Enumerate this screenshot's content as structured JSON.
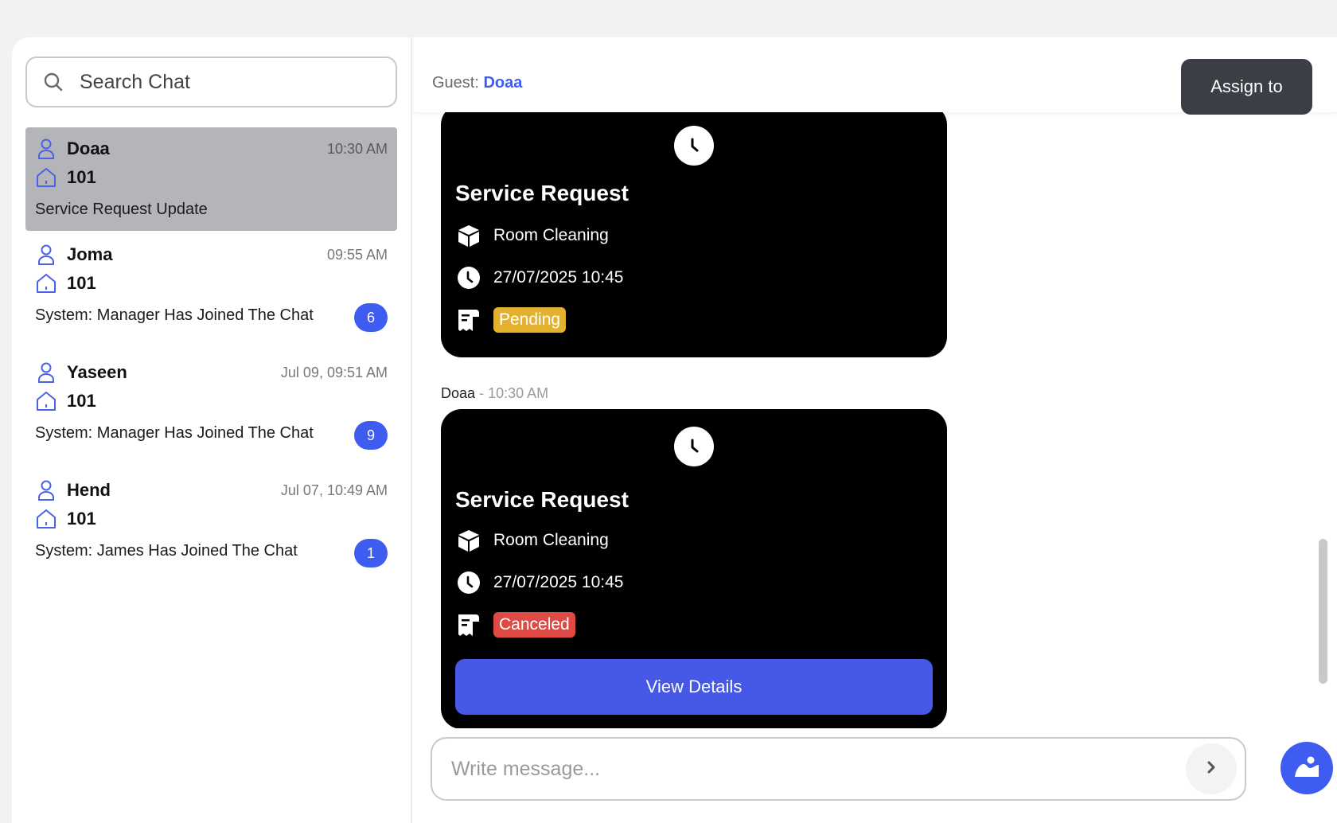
{
  "search": {
    "placeholder": "Search Chat"
  },
  "chats": [
    {
      "name": "Doaa",
      "time": "10:30 AM",
      "room": "101",
      "message": "Service Request Update",
      "unread": ""
    },
    {
      "name": "Joma",
      "time": "09:55 AM",
      "room": "101",
      "message": "System: Manager Has Joined The Chat",
      "unread": "6"
    },
    {
      "name": "Yaseen",
      "time": "Jul 09, 09:51 AM",
      "room": "101",
      "message": "System: Manager Has Joined The Chat",
      "unread": "9"
    },
    {
      "name": "Hend",
      "time": "Jul 07, 10:49 AM",
      "room": "101",
      "message": "System: James Has Joined The Chat",
      "unread": "1"
    }
  ],
  "header": {
    "guest_label": "Guest:",
    "guest_name": "Doaa",
    "assign_label": "Assign to"
  },
  "messages": [
    {
      "title": "Service Request",
      "service": "Room Cleaning",
      "datetime": "27/07/2025 10:45",
      "status": "Pending"
    },
    {
      "sender": "Doaa",
      "separator": "-",
      "time": "10:30 AM",
      "title": "Service Request",
      "service": "Room Cleaning",
      "datetime": "27/07/2025 10:45",
      "status": "Canceled",
      "button": "View Details"
    }
  ],
  "composer": {
    "placeholder": "Write message..."
  },
  "colors": {
    "accent": "#3e5cf0",
    "pending": "#e3b12f",
    "canceled": "#df4a44",
    "card": "#000000",
    "active_item": "#b4b5b9"
  }
}
